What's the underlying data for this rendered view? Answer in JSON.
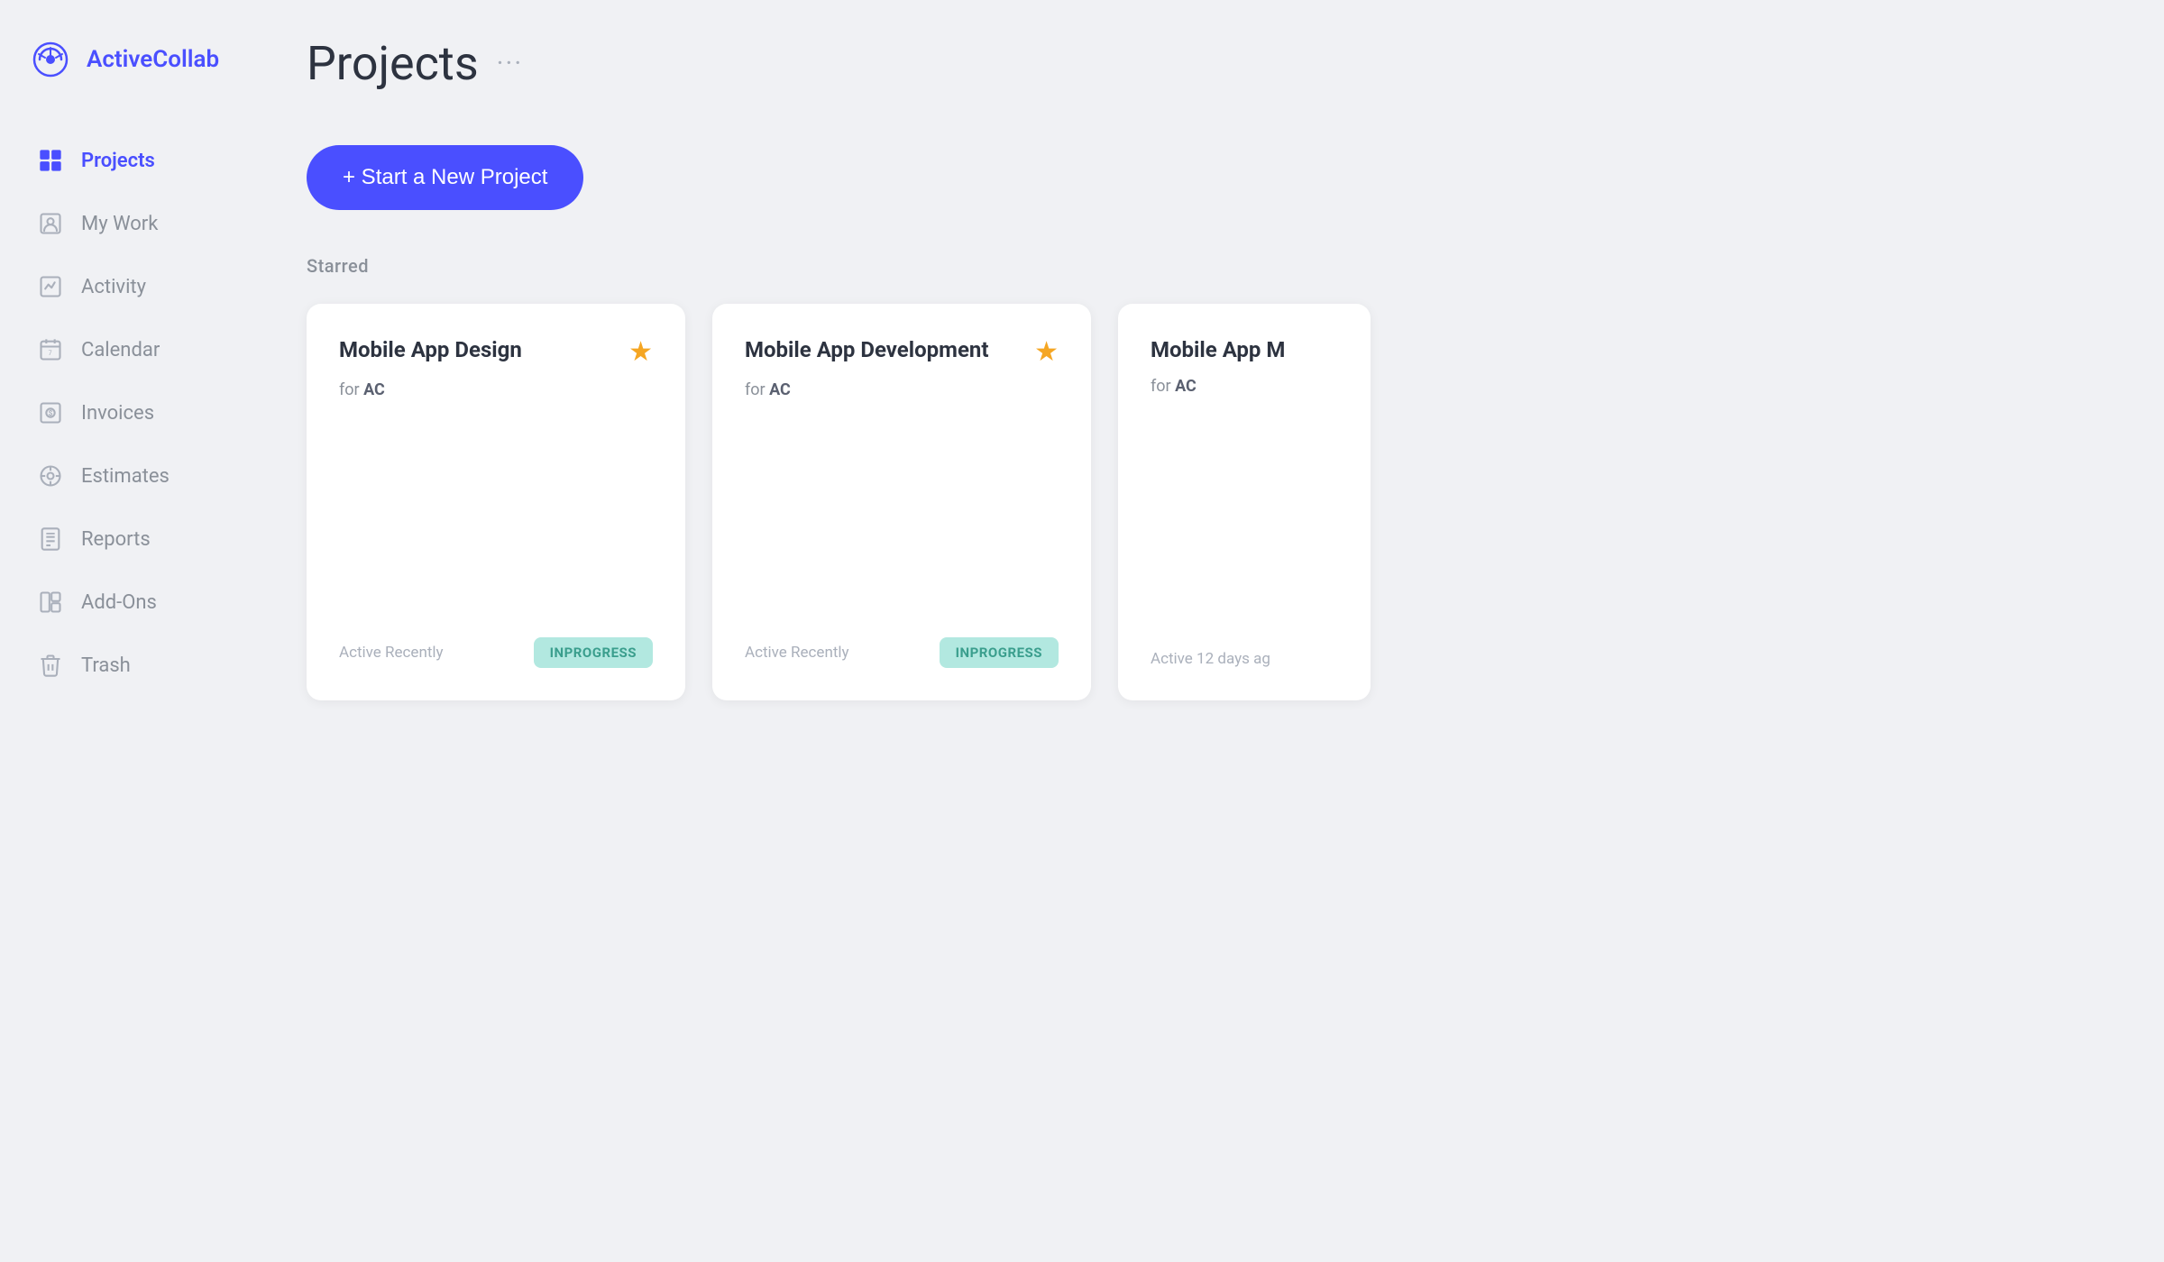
{
  "logo": {
    "text": "ActiveCollab"
  },
  "sidebar": {
    "items": [
      {
        "id": "projects",
        "label": "Projects",
        "active": true
      },
      {
        "id": "my-work",
        "label": "My Work",
        "active": false
      },
      {
        "id": "activity",
        "label": "Activity",
        "active": false
      },
      {
        "id": "calendar",
        "label": "Calendar",
        "active": false
      },
      {
        "id": "invoices",
        "label": "Invoices",
        "active": false
      },
      {
        "id": "estimates",
        "label": "Estimates",
        "active": false
      },
      {
        "id": "reports",
        "label": "Reports",
        "active": false
      },
      {
        "id": "add-ons",
        "label": "Add-Ons",
        "active": false
      },
      {
        "id": "trash",
        "label": "Trash",
        "active": false
      }
    ]
  },
  "page": {
    "title": "Projects",
    "more_label": "···",
    "new_project_label": "+ Start a New Project",
    "starred_section_label": "Starred"
  },
  "projects": [
    {
      "title": "Mobile App Design",
      "client": "AC",
      "starred": true,
      "activity": "Active Recently",
      "status": "INPROGRESS"
    },
    {
      "title": "Mobile App Development",
      "client": "AC",
      "starred": true,
      "activity": "Active Recently",
      "status": "INPROGRESS"
    },
    {
      "title": "Mobile App M",
      "client": "AC",
      "starred": false,
      "activity": "Active 12 days ag",
      "status": ""
    }
  ]
}
